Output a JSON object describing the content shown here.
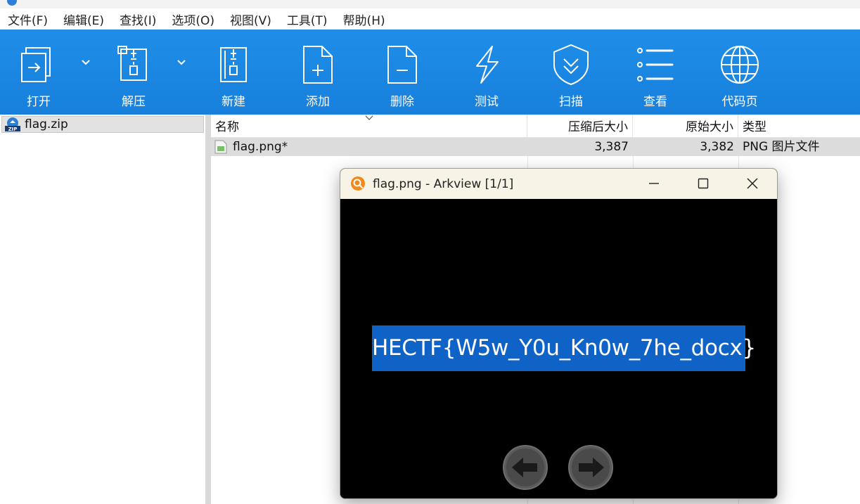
{
  "menubar": {
    "items": [
      {
        "label": "文件(F)"
      },
      {
        "label": "编辑(E)"
      },
      {
        "label": "查找(I)"
      },
      {
        "label": "选项(O)"
      },
      {
        "label": "视图(V)"
      },
      {
        "label": "工具(T)"
      },
      {
        "label": "帮助(H)"
      }
    ]
  },
  "toolbar": {
    "buttons": [
      {
        "label": "打开",
        "icon": "open-icon"
      },
      {
        "label": "解压",
        "icon": "extract-icon"
      },
      {
        "label": "新建",
        "icon": "new-archive-icon"
      },
      {
        "label": "添加",
        "icon": "add-icon"
      },
      {
        "label": "删除",
        "icon": "delete-icon"
      },
      {
        "label": "测试",
        "icon": "test-icon"
      },
      {
        "label": "扫描",
        "icon": "scan-shield-icon"
      },
      {
        "label": "查看",
        "icon": "view-list-icon"
      },
      {
        "label": "代码页",
        "icon": "globe-icon"
      }
    ]
  },
  "tree": {
    "items": [
      {
        "label": "flag.zip",
        "icon": "zip-icon"
      }
    ]
  },
  "filelist": {
    "columns": [
      "名称",
      "压缩后大小",
      "原始大小",
      "类型"
    ],
    "rows": [
      {
        "name": "flag.png*",
        "compressed": "3,387",
        "original": "3,382",
        "type": "PNG 图片文件"
      }
    ]
  },
  "viewer": {
    "title": "flag.png - Arkview [1/1]",
    "image_text": "HECTF{W5w_Y0u_Kn0w_7he_docx}"
  },
  "colors": {
    "toolbar_blue": "#1a86e0",
    "flag_highlight": "#0f63c7",
    "viewer_titlebar": "#f7f3e6"
  }
}
